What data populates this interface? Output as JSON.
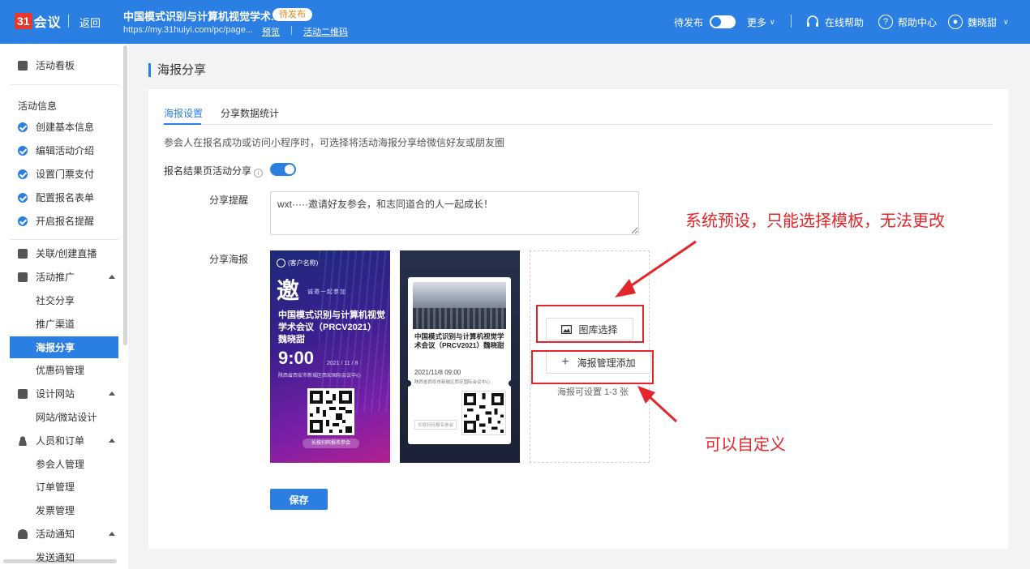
{
  "app": {
    "logo_mark": "31",
    "logo_word": "会议",
    "back": "返回",
    "event_title": "中国模式识别与计算机视觉学术...",
    "status_badge": "待发布",
    "event_url": "https://my.31huiyi.com/pc/page...",
    "preview_link": "预览",
    "qrcode_link": "活动二维码"
  },
  "topbar_right": {
    "publish_label": "待发布",
    "more": "更多",
    "online_help": "在线帮助",
    "help_center": "帮助中心",
    "user": "魏晓甜"
  },
  "sidebar": {
    "dashboard": "活动看板",
    "activity_info_group": "活动信息",
    "steps": [
      "创建基本信息",
      "编辑活动介绍",
      "设置门票支付",
      "配置报名表单",
      "开启报名提醒"
    ],
    "live": "关联/创建直播",
    "promotion": "活动推广",
    "promotion_items": [
      "社交分享",
      "推广渠道",
      "海报分享",
      "优惠码管理"
    ],
    "website": "设计网站",
    "website_items": [
      "网站/微站设计"
    ],
    "people": "人员和订单",
    "people_items": [
      "参会人管理",
      "订单管理",
      "发票管理"
    ],
    "notify": "活动通知",
    "notify_items": [
      "发送通知"
    ]
  },
  "main": {
    "page_title": "海报分享",
    "tabs": [
      "海报设置",
      "分享数据统计"
    ],
    "description": "参会人在报名成功或访问小程序时，可选择将活动海报分享给微信好友或朋友圈",
    "share_toggle_label": "报名结果页活动分享",
    "share_tip_label": "分享提醒",
    "share_tip_value": "wxt·····邀请好友参会，和志同道合的人一起成长！",
    "share_poster_label": "分享海报",
    "gallery_button": "图库选择",
    "add_button": "海报管理添加",
    "poster_hint": "海报可设置 1-3 张",
    "save_button": "保存"
  },
  "poster1": {
    "badge": "(客户名称)",
    "big_char": "邀",
    "tagline": "诚邀一起参加",
    "title": "中国模式识别与计算机视觉学术会议（PRCV2021）魏晓甜",
    "time": "9:00",
    "date": "2021 / 11 / 8",
    "address": "陕西省西安市新城区西安国际会议中心",
    "qr_button": "长按扫码报名参会"
  },
  "poster2": {
    "title": "中国模式识别与计算机视觉学术会议（PRCV2021）魏晓甜",
    "date": "2021/11/8 09:00",
    "address": "陕西省西安市新城区西安国际会议中心",
    "scan": "长按扫码报名参会"
  },
  "annotations": {
    "top": "系统预设，只能选择模板，无法更改",
    "bottom": "可以自定义"
  },
  "colors": {
    "primary": "#2b7fe3",
    "annotation_red": "#e3262b",
    "badge_text": "#e08a1e"
  }
}
